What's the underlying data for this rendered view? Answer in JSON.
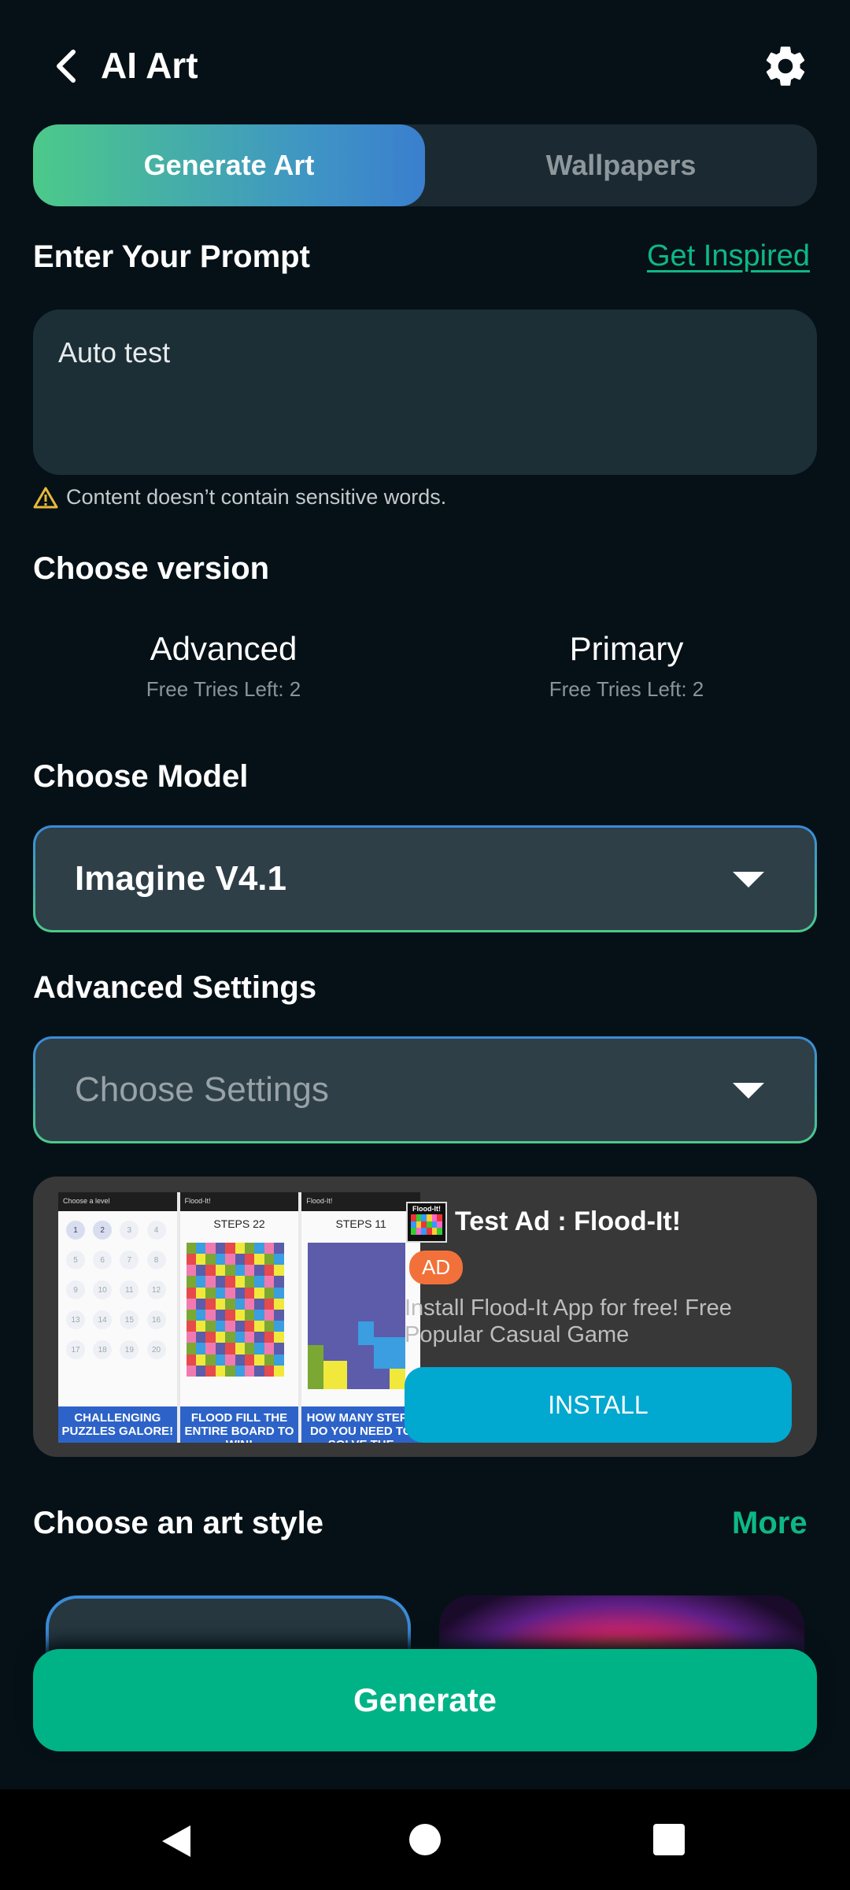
{
  "header": {
    "title": "AI Art"
  },
  "tabs": [
    {
      "label": "Generate Art",
      "active": true
    },
    {
      "label": "Wallpapers",
      "active": false
    }
  ],
  "prompt": {
    "heading": "Enter Your Prompt",
    "inspire_link": "Get Inspired",
    "value": "Auto test",
    "warning": "Content doesn’t contain sensitive words."
  },
  "version": {
    "heading": "Choose version",
    "options": [
      {
        "name": "Advanced",
        "tries": "Free Tries Left: 2"
      },
      {
        "name": "Primary",
        "tries": "Free Tries Left: 2"
      }
    ]
  },
  "model": {
    "heading": "Choose Model",
    "selected": "Imagine V4.1"
  },
  "advanced": {
    "heading": "Advanced Settings",
    "placeholder": "Choose Settings"
  },
  "ad": {
    "title": "Test Ad : Flood-It!",
    "badge": "AD",
    "logo_text": "Flood-It!",
    "description": "Install Flood-It App for free! Free Popular Casual Game",
    "install_label": "INSTALL",
    "shots": [
      {
        "bar": "Choose a level",
        "caption": "CHALLENGING PUZZLES GALORE!",
        "levels": [
          "1",
          "2",
          "3",
          "4",
          "5",
          "6",
          "7",
          "8",
          "9",
          "10",
          "11",
          "12",
          "13",
          "14",
          "15",
          "16",
          "17",
          "18",
          "19",
          "20"
        ]
      },
      {
        "bar": "Flood-It!",
        "steps": "STEPS 22",
        "caption": "FLOOD FILL THE ENTIRE BOARD TO WIN!"
      },
      {
        "bar": "Flood-It!",
        "steps": "STEPS 11",
        "caption": "HOW MANY STEPS DO YOU NEED TO SOLVE THE PUZZLE?"
      }
    ]
  },
  "art_style": {
    "heading": "Choose an art style",
    "more_link": "More"
  },
  "generate": {
    "label": "Generate"
  },
  "colors": {
    "accent": "#0eb886",
    "background": "#061117",
    "install": "#01a8d0",
    "badge": "#f2713a"
  }
}
